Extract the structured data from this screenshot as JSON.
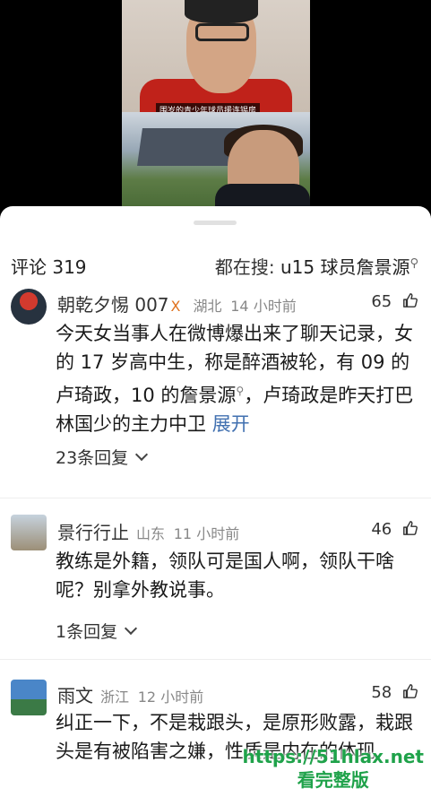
{
  "video": {
    "caption": "围岁的青少年球员援连锡房"
  },
  "header": {
    "comments_label": "评论",
    "comments_count": "319",
    "search_prefix": "都在搜:",
    "search_keyword": "u15 球员詹景源"
  },
  "comments": [
    {
      "name": "朝乾夕惕 007",
      "badge": "X",
      "location": "湖北",
      "time": "14 小时前",
      "likes": "65",
      "text_part1": "今天女当事人在微博爆出来了聊天记录，女的 17 岁高中生，称是醉酒被轮，有 09 的卢琦政，10 的",
      "text_link": "詹景源",
      "text_part2": "，卢琦政是昨天打巴林国少的主力中卫",
      "expand": "展开",
      "replies": "23条回复"
    },
    {
      "name": "景行行止",
      "location": "山东",
      "time": "11 小时前",
      "likes": "46",
      "text": "教练是外籍，领队可是国人啊，领队干啥呢？别拿外教说事。",
      "replies": "1条回复"
    },
    {
      "name": "雨文",
      "location": "浙江",
      "time": "12 小时前",
      "likes": "58",
      "text": "纠正一下，不是栽跟头，是原形败露，栽跟头是有被陷害之嫌，性质是内在的体现"
    }
  ],
  "watermark": {
    "line1": "https://51hlax.net",
    "line2": "看完整版"
  },
  "colors": {
    "accent_link": "#4170b0",
    "vip_orange": "#e0731f",
    "watermark_green": "#1fa24a"
  }
}
